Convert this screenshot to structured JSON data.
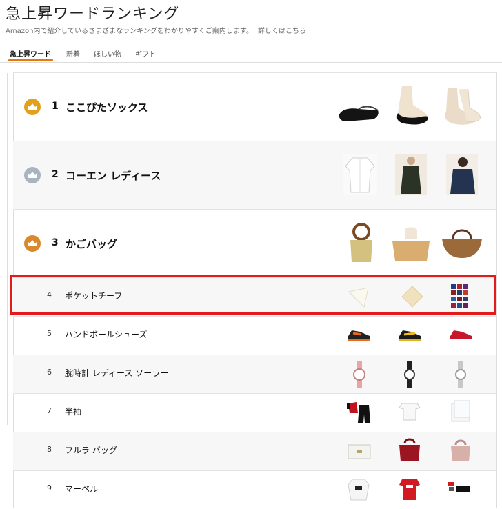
{
  "header": {
    "title": "急上昇ワードランキング",
    "subtitle": "Amazon内で紹介しているさまざまなランキングをわかりやすくご案内します。",
    "details_link": "詳しくはこちら"
  },
  "tabs": [
    {
      "label": "急上昇ワード",
      "active": true
    },
    {
      "label": "新着"
    },
    {
      "label": "ほしい物"
    },
    {
      "label": "ギフト"
    }
  ],
  "accent_color": "#e47911",
  "highlight_color": "#e41a1a",
  "rankings": [
    {
      "rank": "1",
      "term": "ここぴたソックス",
      "crown": "gold",
      "thumbs": [
        "black-footie-sock",
        "black-footie-sock-on-foot",
        "beige-footie-socks"
      ]
    },
    {
      "rank": "2",
      "term": "コーエン レディース",
      "crown": "silver",
      "thumbs": [
        "white-shirt",
        "dark-dress",
        "navy-shirt-model"
      ]
    },
    {
      "rank": "3",
      "term": "かごバッグ",
      "crown": "bronze",
      "thumbs": [
        "basket-bag-round-handle",
        "wicker-bag",
        "straw-tote"
      ]
    },
    {
      "rank": "4",
      "term": "ポケットチーフ",
      "thumbs": [
        "white-pocket-square",
        "cream-pocket-square",
        "pocket-square-set"
      ]
    },
    {
      "rank": "5",
      "term": "ハンドボールシューズ",
      "thumbs": [
        "black-orange-shoe",
        "black-yellow-shoe",
        "red-shoe"
      ]
    },
    {
      "rank": "6",
      "term": "腕時計 レディース ソーラー",
      "thumbs": [
        "pink-watch",
        "black-watch",
        "silver-watch"
      ]
    },
    {
      "rank": "7",
      "term": "半袖",
      "thumbs": [
        "red-black-sportswear",
        "white-tshirts",
        "white-tshirt-pack"
      ]
    },
    {
      "rank": "8",
      "term": "フルラ バッグ",
      "thumbs": [
        "white-handbag",
        "red-handbag",
        "pink-handbag"
      ]
    },
    {
      "rank": "9",
      "term": "マーベル",
      "thumbs": [
        "white-sweatshirt",
        "red-tshirt",
        "marvel-item"
      ]
    }
  ]
}
